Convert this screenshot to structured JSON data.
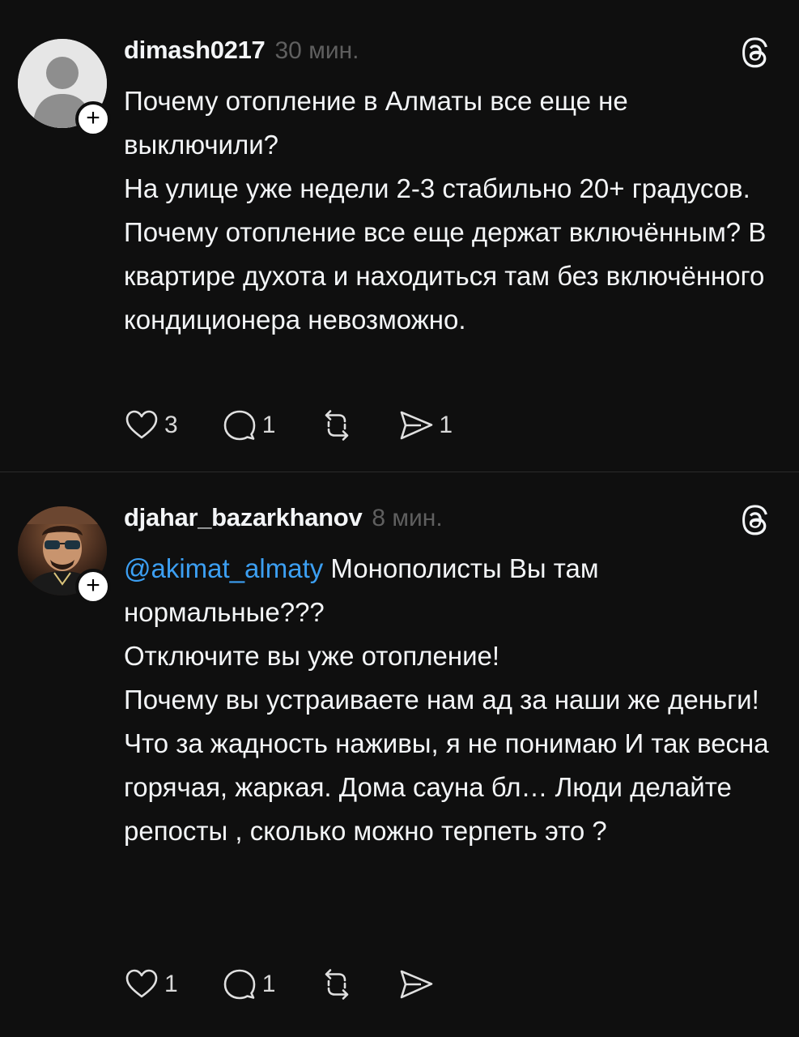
{
  "posts": [
    {
      "username": "dimash0217",
      "time": "30 мин.",
      "paragraphs": [
        "Почему отопление в Алматы все еще не выключили?",
        "На улице уже недели 2-3 стабильно 20+ градусов. Почему отопление все еще держат включённым? В квартире духота и находиться там без включённого кондиционера невозможно."
      ],
      "likes": "3",
      "replies": "1",
      "reposts": "",
      "shares": "1",
      "avatar_icon": "default-avatar-icon"
    },
    {
      "username": "djahar_bazarkhanov",
      "time": "8 мин.",
      "mention": "@akimat_almaty",
      "paragraphs": [
        " Монополисты Вы там нормальные???",
        "Отключите вы уже отопление!",
        "Почему вы устраиваете нам ад за наши же деньги!",
        "Что за жадность наживы, я не понимаю И так весна горячая, жаркая. Дома сауна бл… Люди делайте репосты , сколько можно терпеть это ?"
      ],
      "likes": "1",
      "replies": "1",
      "reposts": "",
      "shares": "",
      "avatar_icon": "user-photo-avatar"
    }
  ],
  "follow_symbol": "+",
  "icons": {
    "like": "heart-icon",
    "reply": "comment-icon",
    "repost": "repost-icon",
    "share": "share-icon",
    "app": "threads-logo-icon"
  },
  "colors": {
    "background": "#0f0f0f",
    "text": "#f3f5f7",
    "muted": "#5f5f5f",
    "mention": "#3c9ff2"
  }
}
